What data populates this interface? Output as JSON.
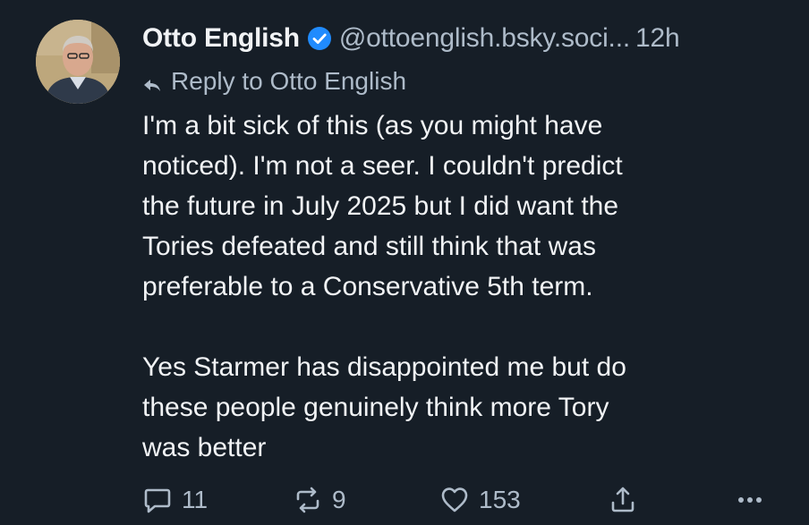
{
  "post": {
    "author": {
      "display_name": "Otto English",
      "handle": "@ottoenglish.bsky.soci...",
      "verified": true
    },
    "time": "12h",
    "reply_to": "Reply to Otto English",
    "text": "I'm a bit sick of this (as you might have\nnoticed). I'm not a seer. I couldn't predict\nthe future in July 2025 but I did want the\nTories defeated and still think that was\npreferable to a Conservative 5th term.\n\nYes Starmer has disappointed me but do\nthese people genuinely think more Tory\nwas better",
    "counts": {
      "replies": "11",
      "reposts": "9",
      "likes": "153"
    }
  },
  "icons": {
    "verified": "verified-check-icon",
    "reply_to": "reply-arrow-icon",
    "reply": "speech-bubble-icon",
    "repost": "repost-icon",
    "like": "heart-icon",
    "share": "share-icon",
    "more": "more-dots-icon"
  },
  "colors": {
    "background": "#161e27",
    "text": "#f1f3f5",
    "muted": "#aebbc9",
    "verified": "#208bfe"
  }
}
